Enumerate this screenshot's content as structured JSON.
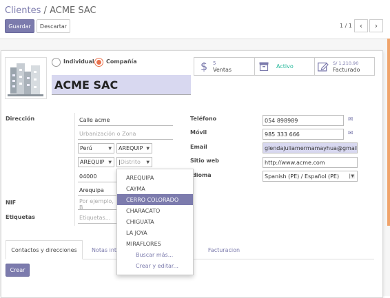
{
  "breadcrumb": {
    "parent": "Clientes",
    "separator": "/",
    "current": "ACME SAC"
  },
  "toolbar": {
    "save_label": "Guardar",
    "discard_label": "Descartar"
  },
  "pager": {
    "value": "1 / 1"
  },
  "company_type": {
    "individual_label": "Individual",
    "company_label": "Compañía",
    "selected": "company"
  },
  "partner_name": "ACME SAC",
  "stats": {
    "sales": {
      "count": "5",
      "label": "Ventas"
    },
    "active": {
      "label": "Activo"
    },
    "invoiced": {
      "amount": "S/ 1,210.90",
      "label": "Facturado"
    }
  },
  "address": {
    "label": "Dirección",
    "street": "Calle acme",
    "street2_placeholder": "Urbanización o Zona",
    "country": "Perú",
    "state": "AREQUIP",
    "province": "AREQUIP",
    "district_placeholder": "Distrito",
    "zip": "04000",
    "city": "Arequipa"
  },
  "nif": {
    "label": "NIF",
    "placeholder": "Por ejemplo, B"
  },
  "tags": {
    "label": "Etiquetas",
    "placeholder": "Etiquetas..."
  },
  "contact": {
    "phone_label": "Teléfono",
    "phone": "054 898989",
    "mobile_label": "Móvil",
    "mobile": "985 333 666",
    "email_label": "Email",
    "email": "glendajuliamermamayhua@gmail",
    "website_label": "Sitio web",
    "website": "http://www.acme.com",
    "lang_label": "Idioma",
    "lang": "Spanish (PE) / Español (PE)"
  },
  "district_dropdown": {
    "items": [
      "AREQUIPA",
      "CAYMA",
      "CERRO COLORADO",
      "CHARACATO",
      "CHIGUATA",
      "LA JOYA",
      "MIRAFLORES"
    ],
    "active": "CERRO COLORADO",
    "search_more": "Buscar más...",
    "create_edit": "Crear y editar..."
  },
  "tabs": [
    "Contactos y direcciones",
    "Notas inte",
    "Facturacion"
  ],
  "create_button": "Crear",
  "colors": {
    "accent": "#7c7bad",
    "name_bg": "#d8d8f0",
    "email_bg": "#d8d8f0",
    "scroll_orange": "#f0a36b"
  }
}
